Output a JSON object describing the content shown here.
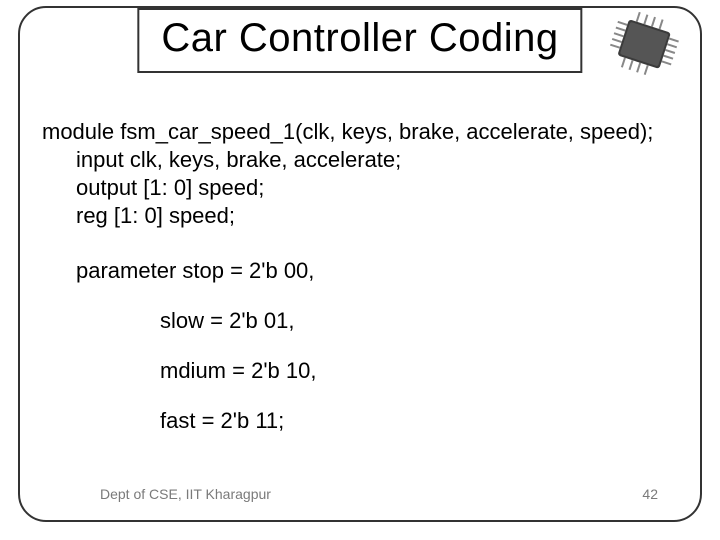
{
  "title": "Car Controller Coding",
  "code": {
    "l1": "module fsm_car_speed_1(clk, keys, brake, accelerate, speed);",
    "l2": "input clk, keys, brake, accelerate;",
    "l3": "output [1: 0] speed;",
    "l4": "reg [1: 0] speed;",
    "p1": "parameter stop   = 2'b 00,",
    "p2": "slow = 2'b 01,",
    "p3": "mdium = 2'b 10,",
    "p4": "fast = 2'b 11;"
  },
  "footer": {
    "left": "Dept of CSE, IIT Kharagpur",
    "right": "42"
  }
}
